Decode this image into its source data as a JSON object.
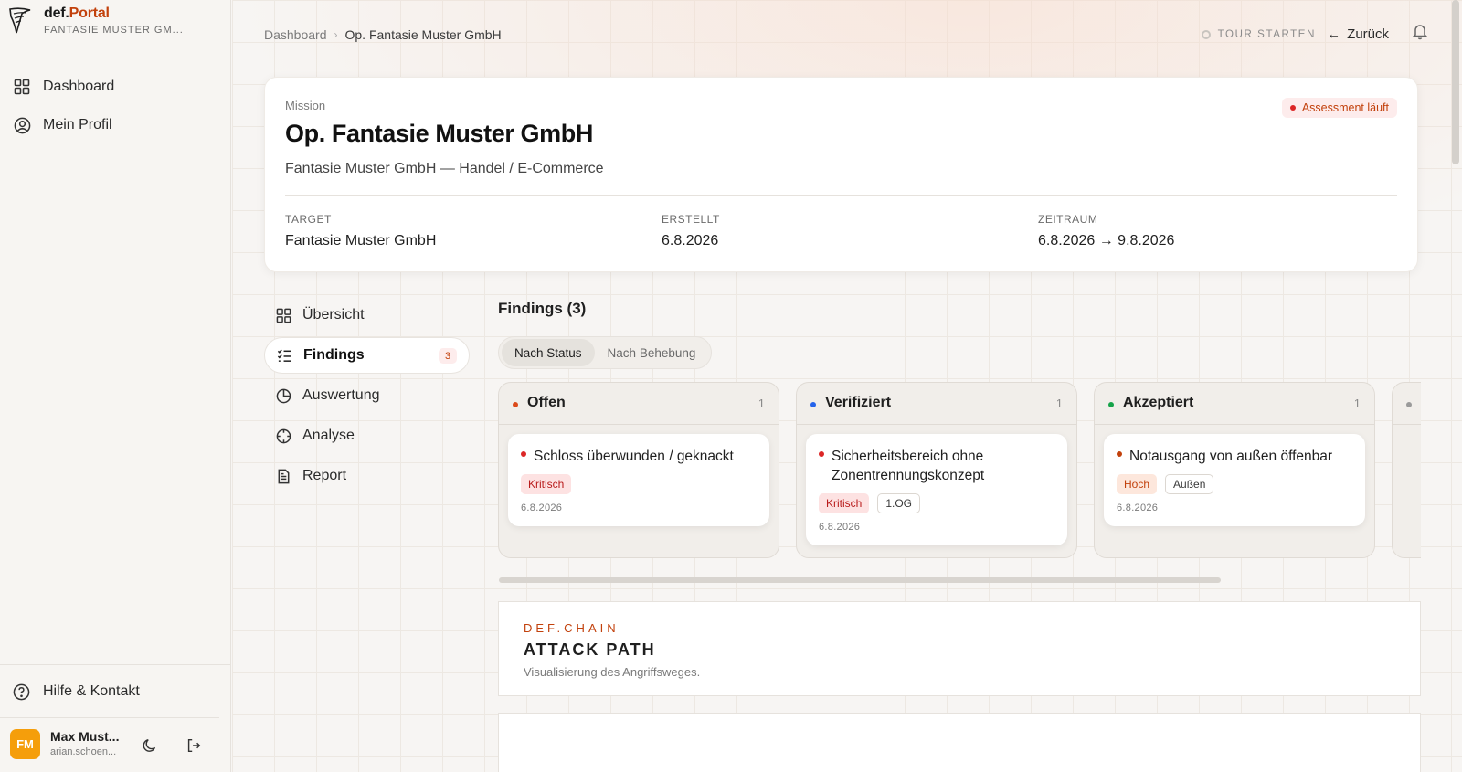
{
  "brand": {
    "prefix": "def.",
    "name": "Portal",
    "org": "FANTASIE MUSTER GM..."
  },
  "sidebar": {
    "items": [
      {
        "label": "Dashboard",
        "icon": "grid-icon"
      },
      {
        "label": "Mein Profil",
        "icon": "user-circle-icon"
      }
    ],
    "help": "Hilfe & Kontakt",
    "user": {
      "initials": "FM",
      "name": "Max Must...",
      "email": "arian.schoen..."
    }
  },
  "topbar": {
    "breadcrumb": [
      "Dashboard",
      "Op. Fantasie Muster GmbH"
    ],
    "tour": "TOUR STARTEN",
    "back": "Zurück"
  },
  "mission": {
    "label": "Mission",
    "title": "Op. Fantasie Muster GmbH",
    "subtitle": "Fantasie Muster GmbH — Handel / E-Commerce",
    "status": "Assessment läuft",
    "meta": [
      {
        "key": "TARGET",
        "value": "Fantasie Muster GmbH"
      },
      {
        "key": "ERSTELLT",
        "value": "6.8.2026"
      },
      {
        "key": "ZEITRAUM",
        "value": "6.8.2026 → 9.8.2026"
      }
    ]
  },
  "subnav": [
    {
      "label": "Übersicht",
      "icon": "grid-icon"
    },
    {
      "label": "Findings",
      "icon": "checklist-icon",
      "count": "3"
    },
    {
      "label": "Auswertung",
      "icon": "pie-chart-icon"
    },
    {
      "label": "Analyse",
      "icon": "crosshair-icon"
    },
    {
      "label": "Report",
      "icon": "document-icon"
    }
  ],
  "findings": {
    "title": "Findings (3)",
    "views": [
      "Nach Status",
      "Nach Behebung"
    ],
    "columns": [
      {
        "name": "Offen",
        "count": "1",
        "color": "#dc4a1a",
        "card": {
          "title": "Schloss überwunden / geknackt",
          "tags": [
            "Kritisch"
          ],
          "date": "6.8.2026"
        }
      },
      {
        "name": "Verifiziert",
        "count": "1",
        "color": "#2563eb",
        "card": {
          "title": "Sicherheitsbereich ohne Zonentrennungskonzept",
          "tags": [
            "Kritisch",
            "1.OG"
          ],
          "date": "6.8.2026"
        }
      },
      {
        "name": "Akzeptiert",
        "count": "1",
        "color": "#16a34a",
        "card": {
          "title": "Notausgang von außen öffenbar",
          "tags": [
            "Hoch",
            "Außen"
          ],
          "date": "6.8.2026"
        }
      }
    ]
  },
  "chain": {
    "kicker": "DEF.CHAIN",
    "title": "ATTACK PATH",
    "desc": "Visualisierung des Angriffsweges."
  },
  "colors": {
    "accent": "#c2410c",
    "critical": "#dc2626",
    "avatar": "#f59e0b"
  }
}
